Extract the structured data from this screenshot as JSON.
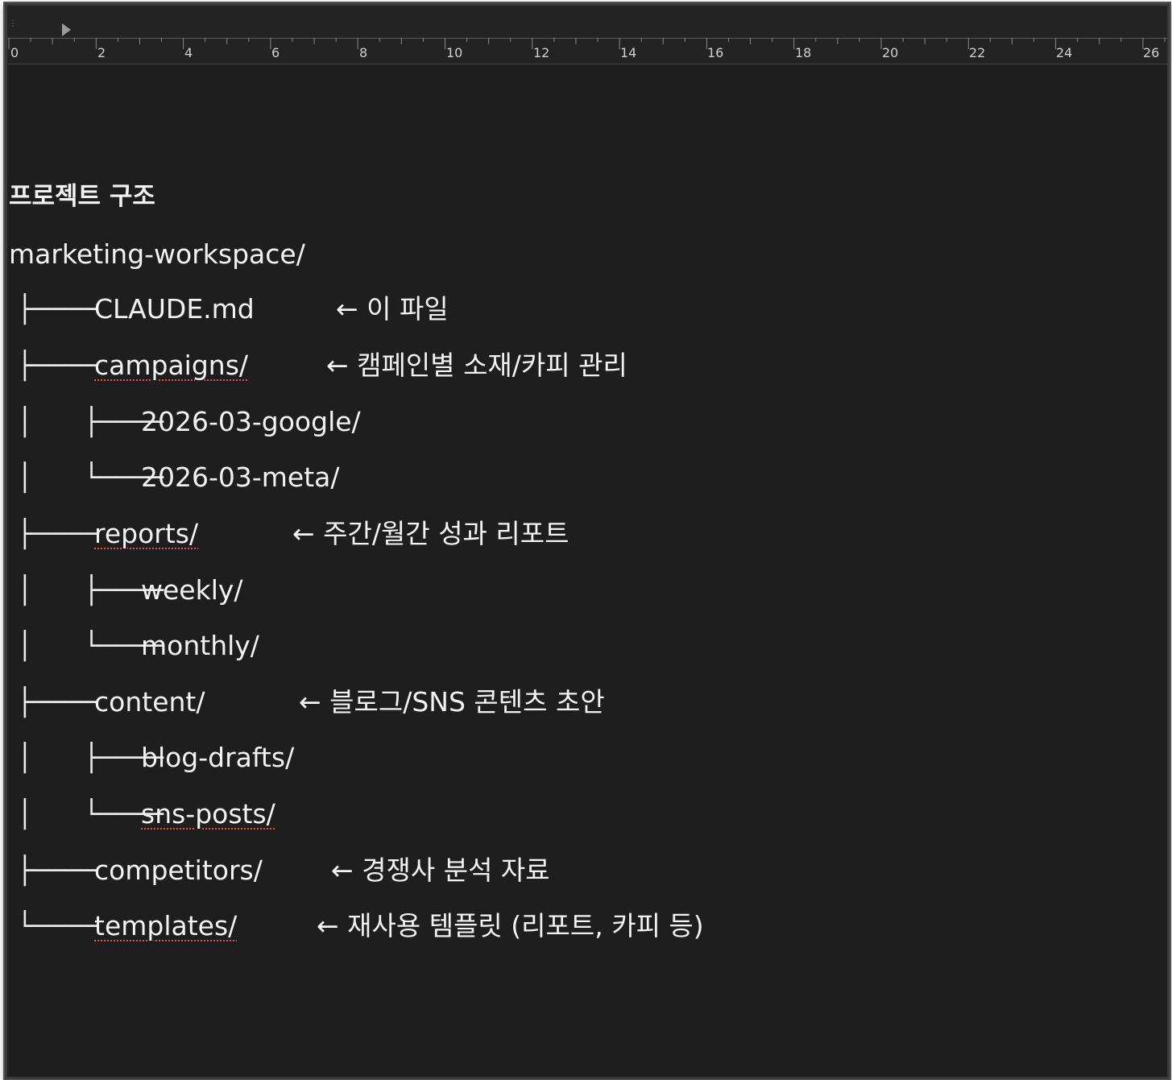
{
  "ruler": {
    "labels": [
      "0",
      "2",
      "4",
      "6",
      "8",
      "10",
      "12",
      "14",
      "16",
      "18",
      "20",
      "22",
      "24",
      "26"
    ]
  },
  "document": {
    "heading": "프로젝트 구조",
    "root": "marketing-workspace/",
    "rows": [
      {
        "prefix": "├──── ",
        "name": "CLAUDE.md",
        "comment": "← 이 파일"
      },
      {
        "prefix": "├──── ",
        "name": "campaigns/",
        "comment": "← 캠페인별 소재/카피 관리"
      },
      {
        "prefix": "│      ├──── ",
        "name": "2026-03-google/",
        "comment": ""
      },
      {
        "prefix": "│      └──── ",
        "name": "2026-03-meta/",
        "comment": ""
      },
      {
        "prefix": "├──── ",
        "name": "reports/",
        "comment": "← 주간/월간 성과 리포트"
      },
      {
        "prefix": "│      ├──── ",
        "name": "weekly/",
        "comment": ""
      },
      {
        "prefix": "│      └──── ",
        "name": "monthly/",
        "comment": ""
      },
      {
        "prefix": "├──── ",
        "name": "content/",
        "comment": "← 블로그/SNS 콘텐츠 초안"
      },
      {
        "prefix": "│      ├──── ",
        "name": "blog-drafts/",
        "comment": ""
      },
      {
        "prefix": "│      └──── ",
        "name": "sns-posts/",
        "comment": ""
      },
      {
        "prefix": "├──── ",
        "name": "competitors/",
        "comment": "← 경쟁사 분석 자료"
      },
      {
        "prefix": "└──── ",
        "name": "templates/",
        "comment": "← 재사용 템플릿 (리포트, 카피 등)"
      }
    ]
  },
  "colors": {
    "background": "#1e1e1e",
    "text": "#f2f2f2",
    "spellcheck": "#e05252"
  }
}
